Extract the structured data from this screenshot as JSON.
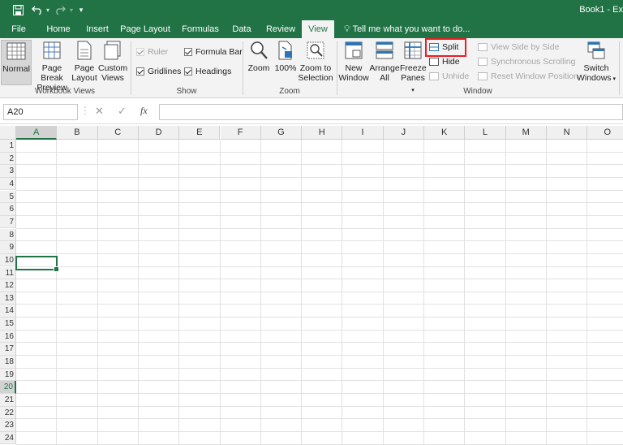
{
  "window": {
    "title": "Book1 - Ex"
  },
  "quick_access": {
    "save_icon": "save-icon",
    "undo_icon": "undo-icon",
    "redo_icon": "redo-icon",
    "customize_icon": "customize-icon"
  },
  "tabs": [
    {
      "label": "File"
    },
    {
      "label": "Home"
    },
    {
      "label": "Insert"
    },
    {
      "label": "Page Layout"
    },
    {
      "label": "Formulas"
    },
    {
      "label": "Data"
    },
    {
      "label": "Review"
    },
    {
      "label": "View",
      "active": true
    }
  ],
  "tell_me": "Tell me what you want to do...",
  "ribbon": {
    "workbook_views": {
      "label": "Workbook Views",
      "normal": "Normal",
      "page_break_1": "Page Break",
      "page_break_2": "Preview",
      "page_layout_1": "Page",
      "page_layout_2": "Layout",
      "custom_1": "Custom",
      "custom_2": "Views"
    },
    "show": {
      "label": "Show",
      "ruler": "Ruler",
      "formula_bar": "Formula Bar",
      "gridlines": "Gridlines",
      "headings": "Headings"
    },
    "zoom": {
      "label": "Zoom",
      "zoom": "Zoom",
      "hundred": "100%",
      "zoom_sel_1": "Zoom to",
      "zoom_sel_2": "Selection"
    },
    "window": {
      "label": "Window",
      "new_window_1": "New",
      "new_window_2": "Window",
      "arrange_1": "Arrange",
      "arrange_2": "All",
      "freeze_1": "Freeze",
      "freeze_2": "Panes",
      "split": "Split",
      "hide": "Hide",
      "unhide": "Unhide",
      "side_by_side": "View Side by Side",
      "sync_scroll": "Synchronous Scrolling",
      "reset_pos": "Reset Window Position",
      "switch_1": "Switch",
      "switch_2": "Windows"
    }
  },
  "formula_bar": {
    "name_box": "A20",
    "cancel": "✕",
    "enter": "✓",
    "fx": "fx",
    "value": ""
  },
  "sheet": {
    "columns": [
      "A",
      "B",
      "C",
      "D",
      "E",
      "F",
      "G",
      "H",
      "I",
      "J",
      "K",
      "L",
      "M",
      "N",
      "O"
    ],
    "rows": [
      "1",
      "2",
      "3",
      "4",
      "5",
      "6",
      "7",
      "8",
      "9",
      "10",
      "11",
      "12",
      "13",
      "14",
      "15",
      "16",
      "17",
      "18",
      "19",
      "20",
      "21",
      "22",
      "23",
      "24"
    ],
    "selected_cell": "A20"
  },
  "colors": {
    "accent": "#217346",
    "highlight": "#e81e25"
  }
}
